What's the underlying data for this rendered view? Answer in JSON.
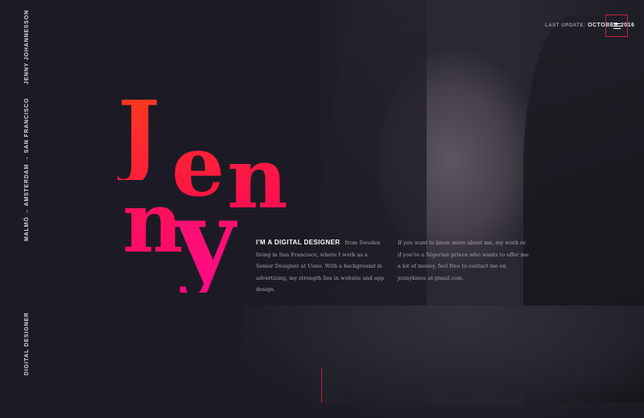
{
  "sidebar": {
    "name": "JENNY JOHANNESSON",
    "cities": "MALMÖ → AMSTERDAM → SAN FRANCISCO",
    "role": "DIGITAL DESIGNER"
  },
  "header": {
    "update_label": "LAST UPDATE:",
    "update_value": "OCTOBER 2016"
  },
  "menu": {
    "icon": "hamburger-icon"
  },
  "hero": {
    "letters": [
      "J",
      "e",
      "n",
      "n",
      "y"
    ]
  },
  "intro": {
    "heading": "I'M A DIGITAL DESIGNER",
    "text": "from Sweden living in San Francisco, where I work as a Senior Designer at Ueno. With a background in advertising, my strength lies in website and app design."
  },
  "contact": {
    "text": "If you want to know more about me, my work or if you're a Nigerian prince who wants to offer me a lot of money, feel free to contact me on jennykines at gmail.com."
  },
  "colors": {
    "background": "#1c1b25",
    "accent": "#ff1a4a",
    "button_border": "#c0223a"
  }
}
